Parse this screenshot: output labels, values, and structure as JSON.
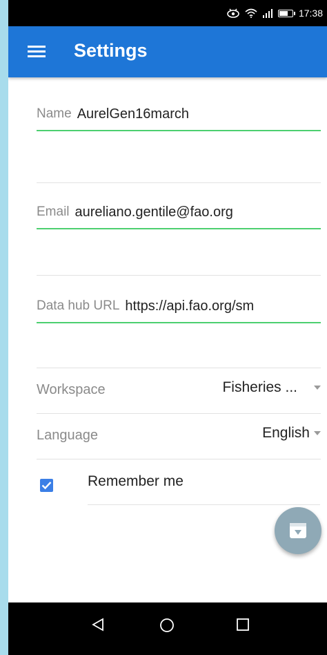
{
  "status_bar": {
    "time": "17:38",
    "battery_level": 0.7,
    "icons": [
      "eye-icon",
      "wifi-icon",
      "signal-icon",
      "battery-icon"
    ]
  },
  "app_bar": {
    "title": "Settings",
    "menu_icon": "hamburger-menu-icon",
    "background": "#1e76d7"
  },
  "fields": [
    {
      "label": "Name",
      "value": "AurelGen16march"
    },
    {
      "label": "Email",
      "value": "aureliano.gentile@fao.org"
    },
    {
      "label": "Data hub URL",
      "value": "https://api.fao.org/sm"
    }
  ],
  "workspace": {
    "label": "Workspace",
    "value": "Fisheries ..."
  },
  "language": {
    "label": "Language",
    "value": "English"
  },
  "remember_me": {
    "label": "Remember me",
    "checked": true
  },
  "fab_icon": "download-archive-icon",
  "nav_bar": [
    "back-icon",
    "home-icon",
    "recents-icon"
  ],
  "colors": {
    "accent": "#1e76d7",
    "underline": "#4ccf6f",
    "checkbox": "#3b7fe6",
    "fab": "#8fa9b6"
  }
}
